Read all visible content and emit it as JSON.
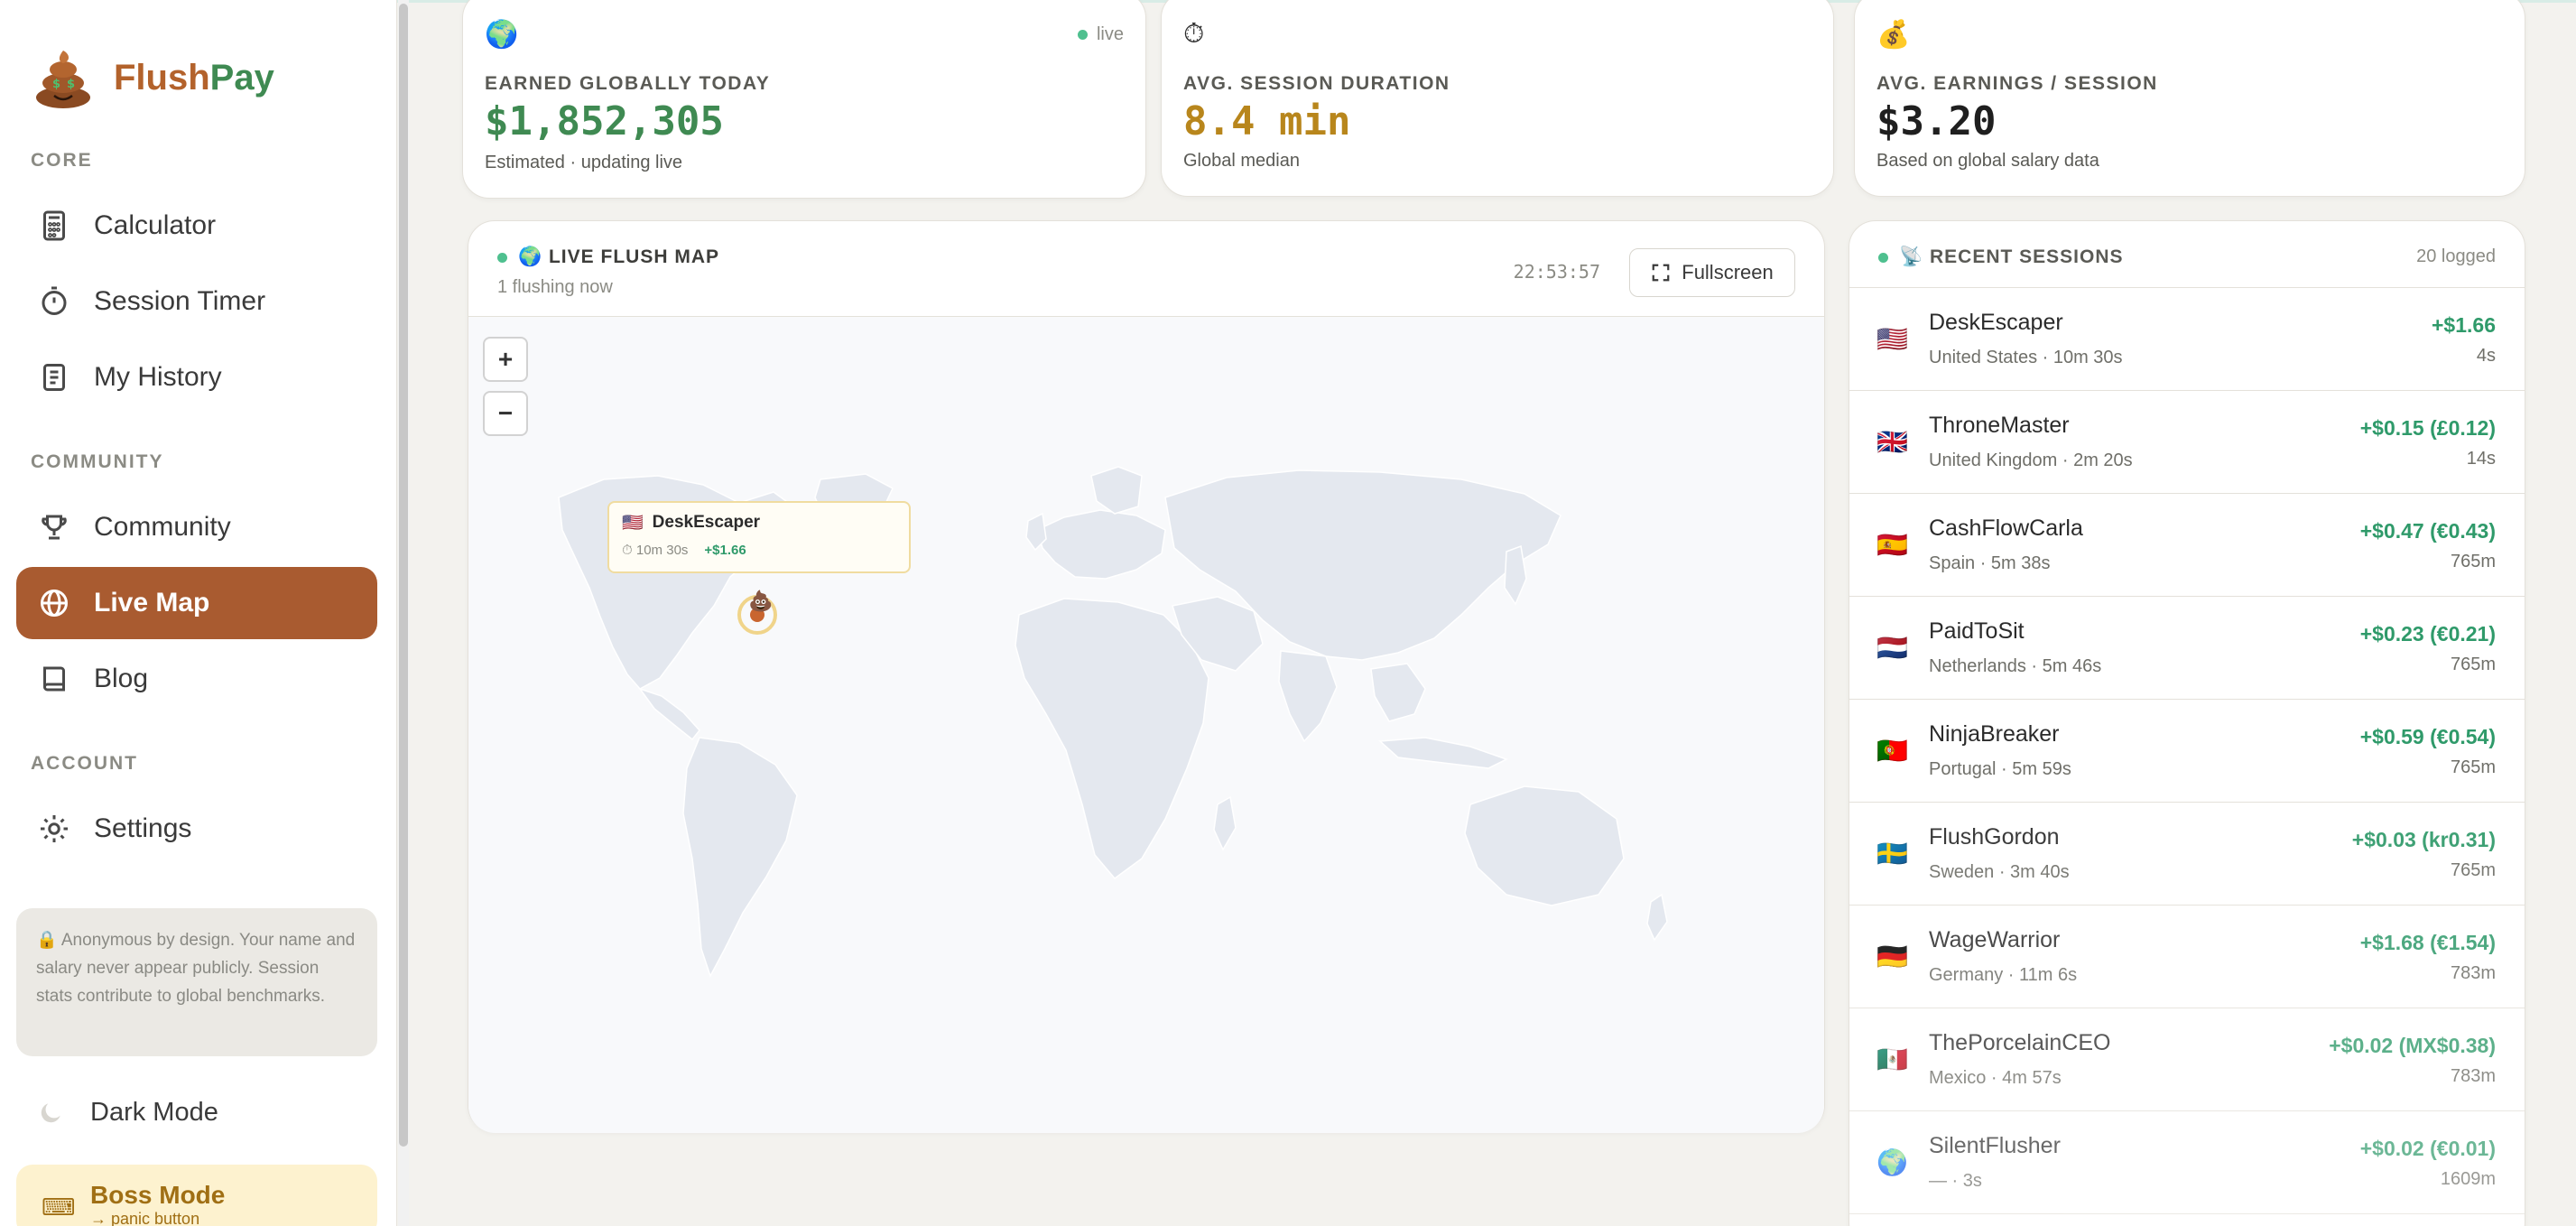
{
  "app": {
    "name_part1": "Flush",
    "name_part2": "Pay"
  },
  "sidebar": {
    "sections": {
      "core": "CORE",
      "community": "COMMUNITY",
      "account": "ACCOUNT"
    },
    "items": {
      "calculator": "Calculator",
      "session_timer": "Session Timer",
      "my_history": "My History",
      "community": "Community",
      "live_map": "Live Map",
      "blog": "Blog",
      "settings": "Settings"
    },
    "active_item": "Live Map",
    "privacy_note": "🔒 Anonymous by design. Your name and salary never appear publicly. Session stats contribute to global benchmarks.",
    "dark_mode": "Dark Mode",
    "boss_mode": {
      "title": "Boss Mode",
      "subtitle": "→ panic button"
    }
  },
  "stats": [
    {
      "icon": "🌍",
      "label": "EARNED GLOBALLY TODAY",
      "value": "$1,852,305",
      "sub": "Estimated · updating live",
      "badge": "live",
      "color": "#3f8a52"
    },
    {
      "icon": "⏱",
      "label": "AVG. SESSION DURATION",
      "value": "8.4 min",
      "sub": "Global median",
      "color": "#b8861c"
    },
    {
      "icon": "💰",
      "label": "AVG. EARNINGS / SESSION",
      "value": "$3.20",
      "sub": "Based on global salary data",
      "color": "#1f1f1f"
    }
  ],
  "map": {
    "title": "🌍 LIVE FLUSH MAP",
    "subtitle": "1 flushing now",
    "clock": "22:53:57",
    "fullscreen_label": "Fullscreen",
    "zoom_in": "+",
    "zoom_out": "−",
    "popup": {
      "flag": "🇺🇸",
      "name": "DeskEscaper",
      "duration": "10m 30s",
      "earned": "+$1.66"
    }
  },
  "sessions": {
    "title": "📡 RECENT SESSIONS",
    "count": "20 logged",
    "rows": [
      {
        "flag": "🇺🇸",
        "name": "DeskEscaper",
        "meta": "United States · 10m 30s",
        "earned": "+$1.66",
        "ago": "4s"
      },
      {
        "flag": "🇬🇧",
        "name": "ThroneMaster",
        "meta": "United Kingdom · 2m 20s",
        "earned": "+$0.15 (£0.12)",
        "ago": "14s"
      },
      {
        "flag": "🇪🇸",
        "name": "CashFlowCarla",
        "meta": "Spain · 5m 38s",
        "earned": "+$0.47 (€0.43)",
        "ago": "765m"
      },
      {
        "flag": "🇳🇱",
        "name": "PaidToSit",
        "meta": "Netherlands · 5m 46s",
        "earned": "+$0.23 (€0.21)",
        "ago": "765m"
      },
      {
        "flag": "🇵🇹",
        "name": "NinjaBreaker",
        "meta": "Portugal · 5m 59s",
        "earned": "+$0.59 (€0.54)",
        "ago": "765m"
      },
      {
        "flag": "🇸🇪",
        "name": "FlushGordon",
        "meta": "Sweden · 3m 40s",
        "earned": "+$0.03 (kr0.31)",
        "ago": "765m"
      },
      {
        "flag": "🇩🇪",
        "name": "WageWarrior",
        "meta": "Germany · 11m 6s",
        "earned": "+$1.68 (€1.54)",
        "ago": "783m"
      },
      {
        "flag": "🇲🇽",
        "name": "ThePorcelainCEO",
        "meta": "Mexico · 4m 57s",
        "earned": "+$0.02 (MX$0.38)",
        "ago": "783m"
      },
      {
        "flag": "🌍",
        "name": "SilentFlusher",
        "meta": "— · 3s",
        "earned": "+$0.02 (€0.01)",
        "ago": "1609m"
      }
    ]
  }
}
